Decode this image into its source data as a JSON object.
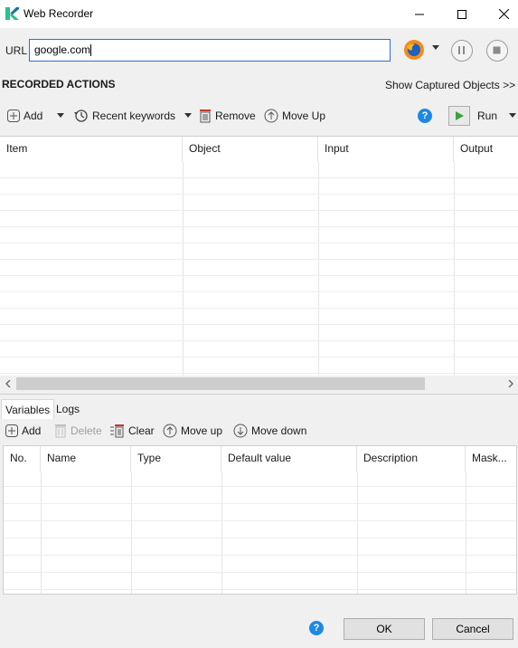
{
  "window": {
    "title": "Web Recorder"
  },
  "url_bar": {
    "label": "URL",
    "value": "google.com"
  },
  "recorded": {
    "title": "RECORDED ACTIONS",
    "show_captured": "Show Captured Objects >>"
  },
  "toolbar": {
    "add": "Add",
    "recent_keywords": "Recent keywords",
    "remove": "Remove",
    "move_up": "Move Up",
    "run": "Run"
  },
  "actions_table": {
    "columns": [
      "Item",
      "Object",
      "Input",
      "Output"
    ]
  },
  "tabs": {
    "variables": "Variables",
    "logs": "Logs"
  },
  "var_toolbar": {
    "add": "Add",
    "delete": "Delete",
    "clear": "Clear",
    "move_up": "Move up",
    "move_down": "Move down"
  },
  "variables_table": {
    "columns": [
      "No.",
      "Name",
      "Type",
      "Default value",
      "Description",
      "Mask..."
    ]
  },
  "footer": {
    "ok": "OK",
    "cancel": "Cancel"
  },
  "colors": {
    "accent": "#2b6fd6",
    "run_green": "#3aa33a",
    "help_blue": "#1e88e5",
    "delete_red": "#c0392b"
  }
}
